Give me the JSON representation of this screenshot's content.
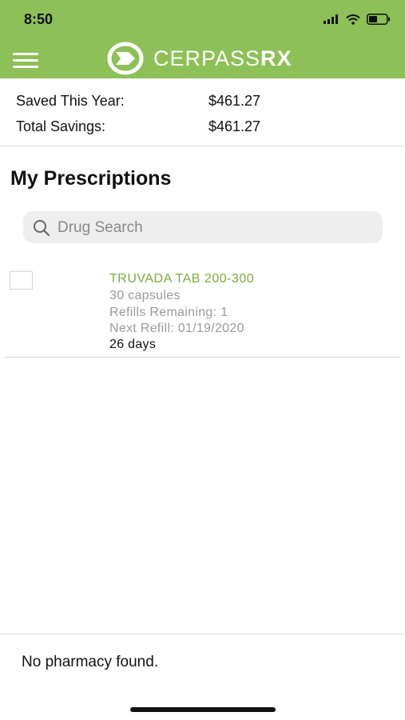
{
  "status_bar": {
    "time": "8:50"
  },
  "header": {
    "logo_text_main": "CERPASS",
    "logo_text_suffix": "RX",
    "brand_color": "#8dc056"
  },
  "savings": {
    "year_label": "Saved This Year:",
    "year_value": "$461.27",
    "total_label": "Total Savings:",
    "total_value": "$461.27"
  },
  "prescriptions": {
    "title": "My Prescriptions",
    "search_placeholder": "Drug Search",
    "items": [
      {
        "name": "TRUVADA TAB 200-300",
        "quantity": "30 capsules",
        "refills": "Refills Remaining: 1",
        "next_refill": "Next Refill: 01/19/2020",
        "days": "26 days"
      }
    ]
  },
  "footer": {
    "pharmacy_text": "No pharmacy found."
  }
}
